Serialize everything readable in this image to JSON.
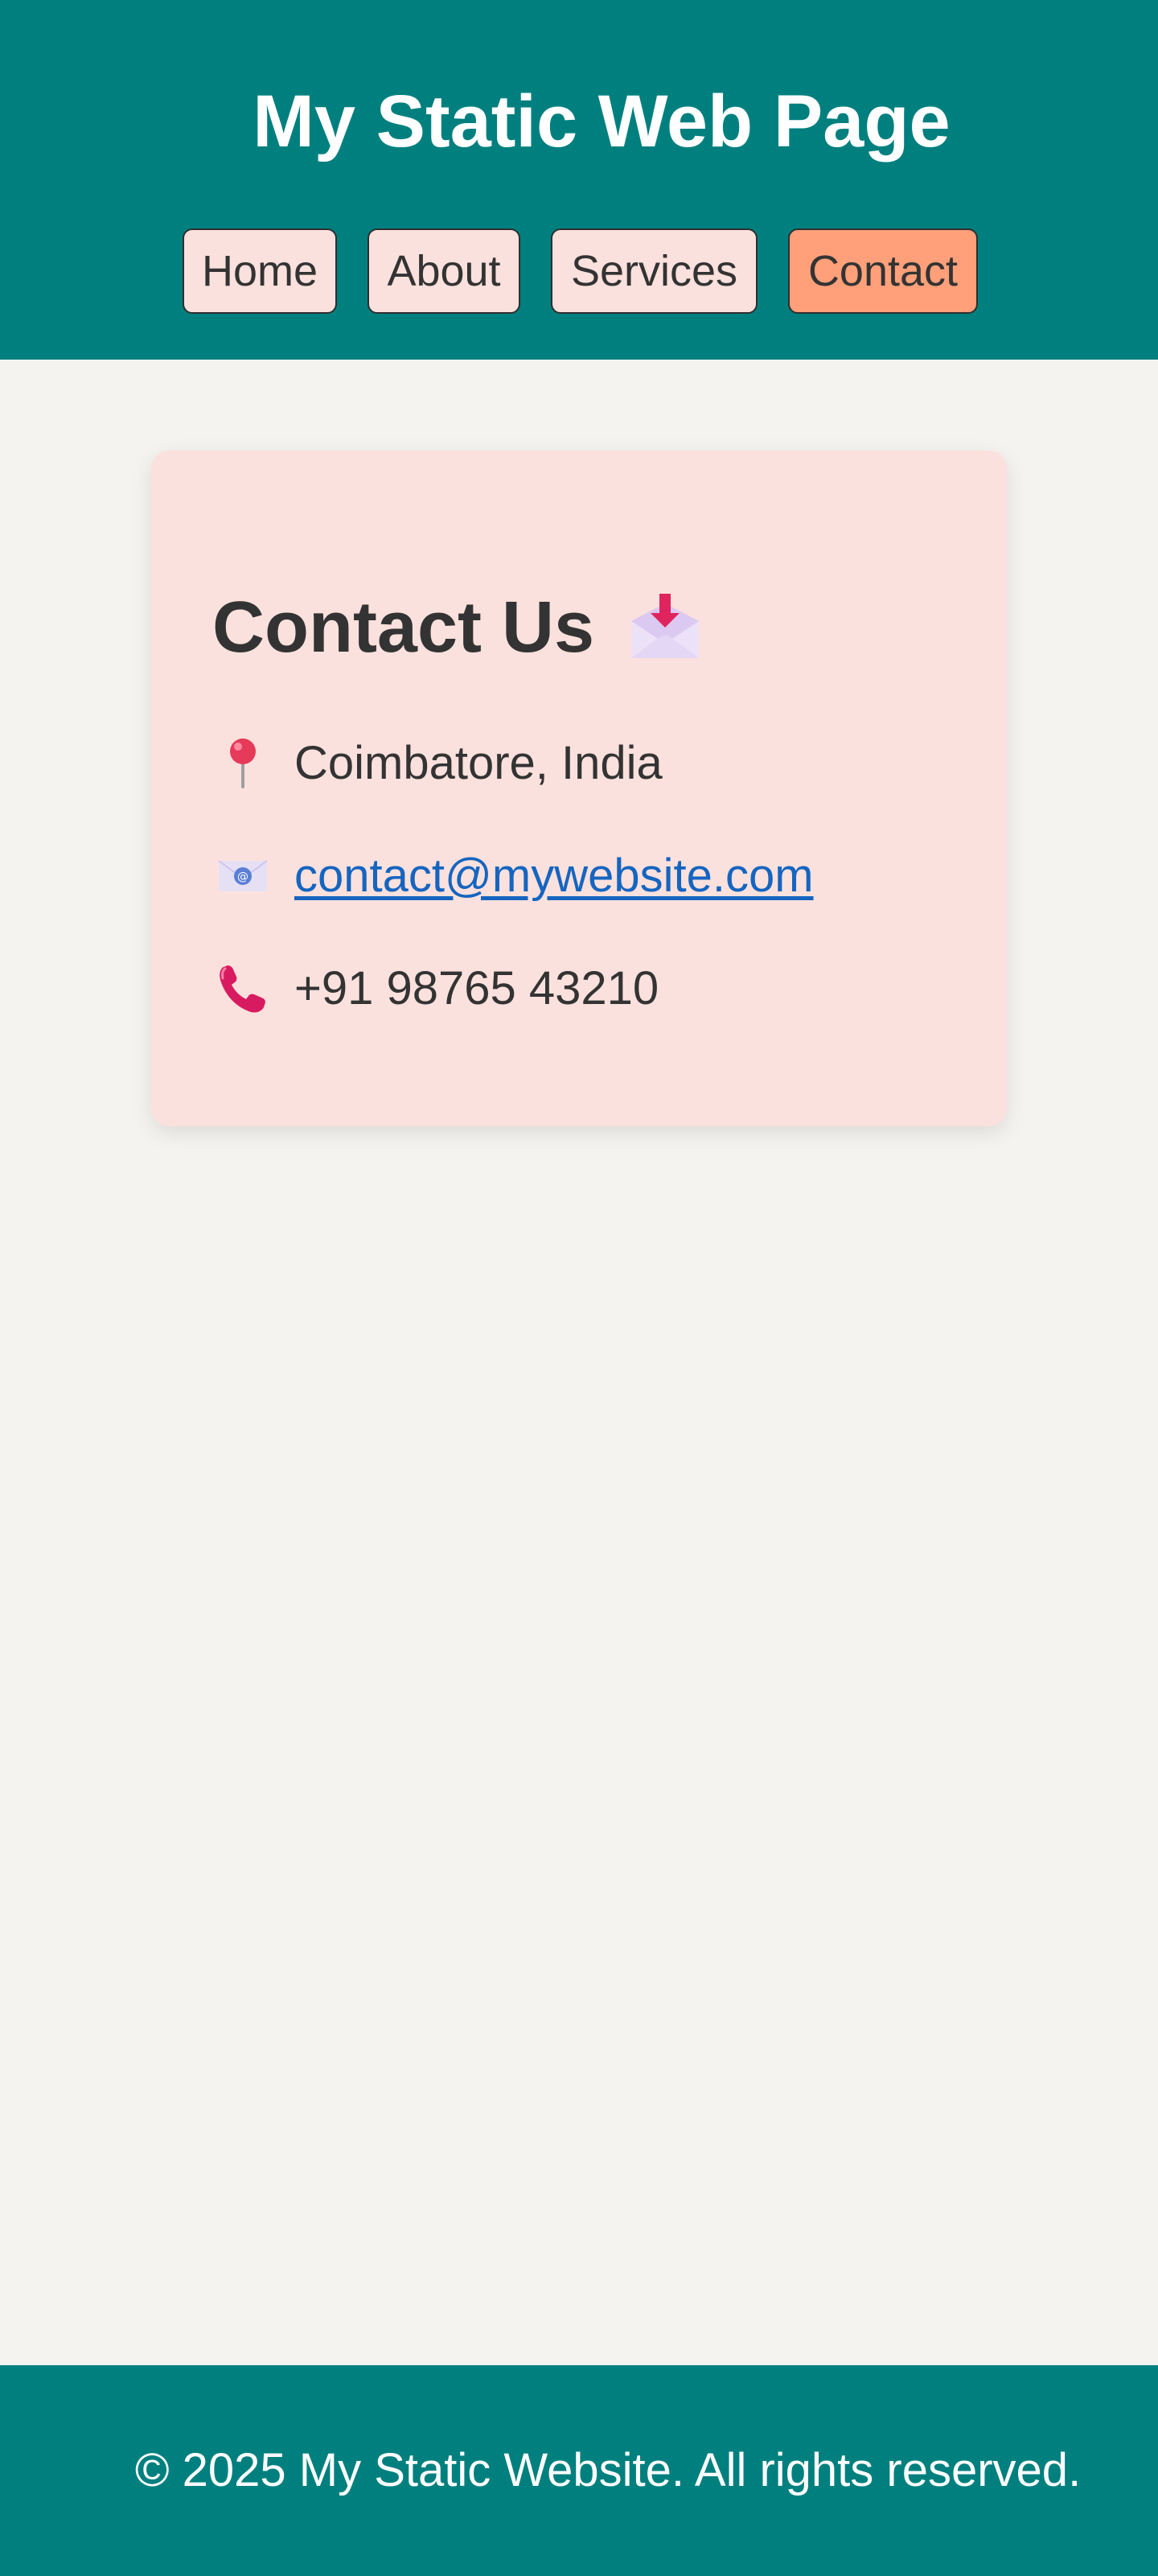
{
  "header": {
    "title": "My Static Web Page",
    "background_color": "#007f7f"
  },
  "nav": {
    "items": [
      {
        "label": "Home",
        "active": false
      },
      {
        "label": "About",
        "active": false
      },
      {
        "label": "Services",
        "active": false
      },
      {
        "label": "Contact",
        "active": true
      }
    ],
    "button_color": "#fbe1dd",
    "active_color": "#ffa07a"
  },
  "contact": {
    "title": "Contact Us",
    "title_icon": "envelope-with-arrow-icon",
    "location": {
      "icon": "round-pushpin-icon",
      "text": "Coimbatore, India"
    },
    "email": {
      "icon": "e-mail-icon",
      "text": "contact@mywebsite.com"
    },
    "phone": {
      "icon": "telephone-receiver-icon",
      "text": "+91 98765 43210"
    },
    "card_color": "#fbe1dd",
    "link_color": "#1565c0"
  },
  "footer": {
    "text": "© 2025 My Static Website. All rights reserved.",
    "background_color": "#007f7f"
  }
}
